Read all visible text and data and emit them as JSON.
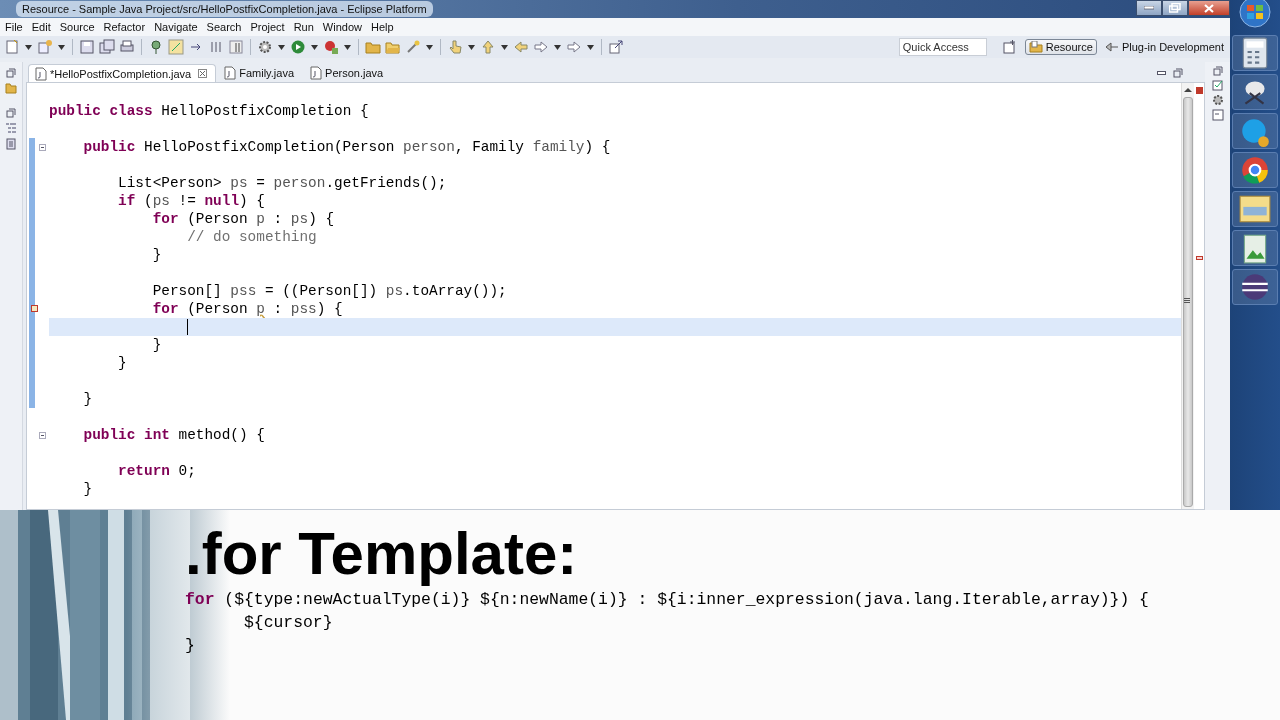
{
  "window": {
    "title": "Resource - Sample Java Project/src/HelloPostfixCompletion.java - Eclipse Platform"
  },
  "menu": [
    "File",
    "Edit",
    "Source",
    "Refactor",
    "Navigate",
    "Search",
    "Project",
    "Run",
    "Window",
    "Help"
  ],
  "quick_access": {
    "placeholder": "Quick Access"
  },
  "perspectives": [
    {
      "label": "Resource",
      "selected": true
    },
    {
      "label": "Plug-in Development",
      "selected": false
    }
  ],
  "tabs": [
    {
      "label": "*HelloPostfixCompletion.java",
      "selected": true
    },
    {
      "label": "Family.java",
      "selected": false
    },
    {
      "label": "Person.java",
      "selected": false
    }
  ],
  "editor": {
    "lines": [
      {
        "current": false,
        "fold": false,
        "changed": false,
        "segments": [
          {
            "kind": "keyword",
            "text": "public class"
          },
          {
            "kind": "plain",
            "text": " HelloPostfixCompletion {"
          }
        ]
      },
      {
        "current": false,
        "fold": false,
        "changed": false
      },
      {
        "current": false,
        "fold": true,
        "changed": true,
        "segments": [
          {
            "kind": "keyword",
            "text": "    public"
          },
          {
            "kind": "plain",
            "text": " HelloPostfixCompletion(Person "
          },
          {
            "kind": "variable",
            "text": "person"
          },
          {
            "kind": "plain",
            "text": ", Family "
          },
          {
            "kind": "variable",
            "text": "family"
          },
          {
            "kind": "plain",
            "text": ") {"
          }
        ]
      },
      {
        "current": false,
        "fold": false,
        "changed": true
      },
      {
        "current": false,
        "fold": false,
        "changed": true,
        "segments": [
          {
            "kind": "plain",
            "text": "        List<Person> "
          },
          {
            "kind": "variable",
            "text": "ps"
          },
          {
            "kind": "plain",
            "text": " = "
          },
          {
            "kind": "variable",
            "text": "person"
          },
          {
            "kind": "plain",
            "text": ".getFriends();"
          }
        ]
      },
      {
        "current": false,
        "fold": false,
        "changed": true,
        "segments": [
          {
            "kind": "keyword",
            "text": "        if"
          },
          {
            "kind": "plain",
            "text": " ("
          },
          {
            "kind": "variable",
            "text": "ps"
          },
          {
            "kind": "plain",
            "text": " != "
          },
          {
            "kind": "keyword",
            "text": "null"
          },
          {
            "kind": "plain",
            "text": ") {"
          }
        ]
      },
      {
        "current": false,
        "fold": false,
        "changed": true,
        "segments": [
          {
            "kind": "keyword",
            "text": "            for"
          },
          {
            "kind": "plain",
            "text": " (Person "
          },
          {
            "kind": "variable",
            "text": "p"
          },
          {
            "kind": "plain",
            "text": " : "
          },
          {
            "kind": "variable",
            "text": "ps"
          },
          {
            "kind": "plain",
            "text": ") {"
          }
        ]
      },
      {
        "current": false,
        "fold": false,
        "changed": true,
        "segments": [
          {
            "kind": "comment",
            "text": "                // do something"
          }
        ]
      },
      {
        "current": false,
        "fold": false,
        "changed": true,
        "segments": [
          {
            "kind": "plain",
            "text": "            }"
          }
        ]
      },
      {
        "current": false,
        "fold": false,
        "changed": true
      },
      {
        "current": false,
        "fold": false,
        "changed": true,
        "segments": [
          {
            "kind": "plain",
            "text": "            Person[] "
          },
          {
            "kind": "variable",
            "text": "pss"
          },
          {
            "kind": "plain",
            "text": " = ((Person[]) "
          },
          {
            "kind": "variable",
            "text": "ps"
          },
          {
            "kind": "plain",
            "text": ".toArray());"
          }
        ]
      },
      {
        "current": false,
        "fold": false,
        "changed": true,
        "segments": [
          {
            "kind": "keyword",
            "text": "            for"
          },
          {
            "kind": "plain",
            "text": " (Person "
          },
          {
            "kind": "warning",
            "text": "p"
          },
          {
            "kind": "plain",
            "text": " : "
          },
          {
            "kind": "variable",
            "text": "pss"
          },
          {
            "kind": "plain",
            "text": ") {"
          }
        ]
      },
      {
        "current": true,
        "fold": false,
        "changed": true
      },
      {
        "current": false,
        "fold": false,
        "changed": true,
        "segments": [
          {
            "kind": "plain",
            "text": "            }"
          }
        ]
      },
      {
        "current": false,
        "fold": false,
        "changed": true,
        "segments": [
          {
            "kind": "plain",
            "text": "        }"
          }
        ]
      },
      {
        "current": false,
        "fold": false,
        "changed": true
      },
      {
        "current": false,
        "fold": false,
        "changed": true,
        "segments": [
          {
            "kind": "plain",
            "text": "    }"
          }
        ]
      },
      {
        "current": false,
        "fold": false,
        "changed": false
      },
      {
        "current": false,
        "fold": true,
        "changed": false,
        "segments": [
          {
            "kind": "keyword",
            "text": "    public int"
          },
          {
            "kind": "plain",
            "text": " method() {"
          }
        ]
      },
      {
        "current": false,
        "fold": false,
        "changed": false
      },
      {
        "current": false,
        "fold": false,
        "changed": false,
        "segments": [
          {
            "kind": "keyword",
            "text": "        return"
          },
          {
            "kind": "plain",
            "text": " 0;"
          }
        ]
      },
      {
        "current": false,
        "fold": false,
        "changed": false,
        "segments": [
          {
            "kind": "plain",
            "text": "    }"
          }
        ]
      }
    ]
  },
  "overlay": {
    "kind": "picture",
    "heading": ".for Template:",
    "lines": [
      {
        "segments": [
          {
            "kind": "keyword",
            "text": "for"
          },
          {
            "kind": "plain",
            "text": " (${type:newActualType(i)} ${n:newName(i)} : ${i:inner_expression(java.lang.Iterable,array)}) {"
          }
        ]
      },
      {
        "segments": [
          {
            "kind": "plain",
            "text": "      ${cursor}"
          }
        ]
      },
      {
        "segments": [
          {
            "kind": "plain",
            "text": "}"
          }
        ]
      }
    ]
  }
}
